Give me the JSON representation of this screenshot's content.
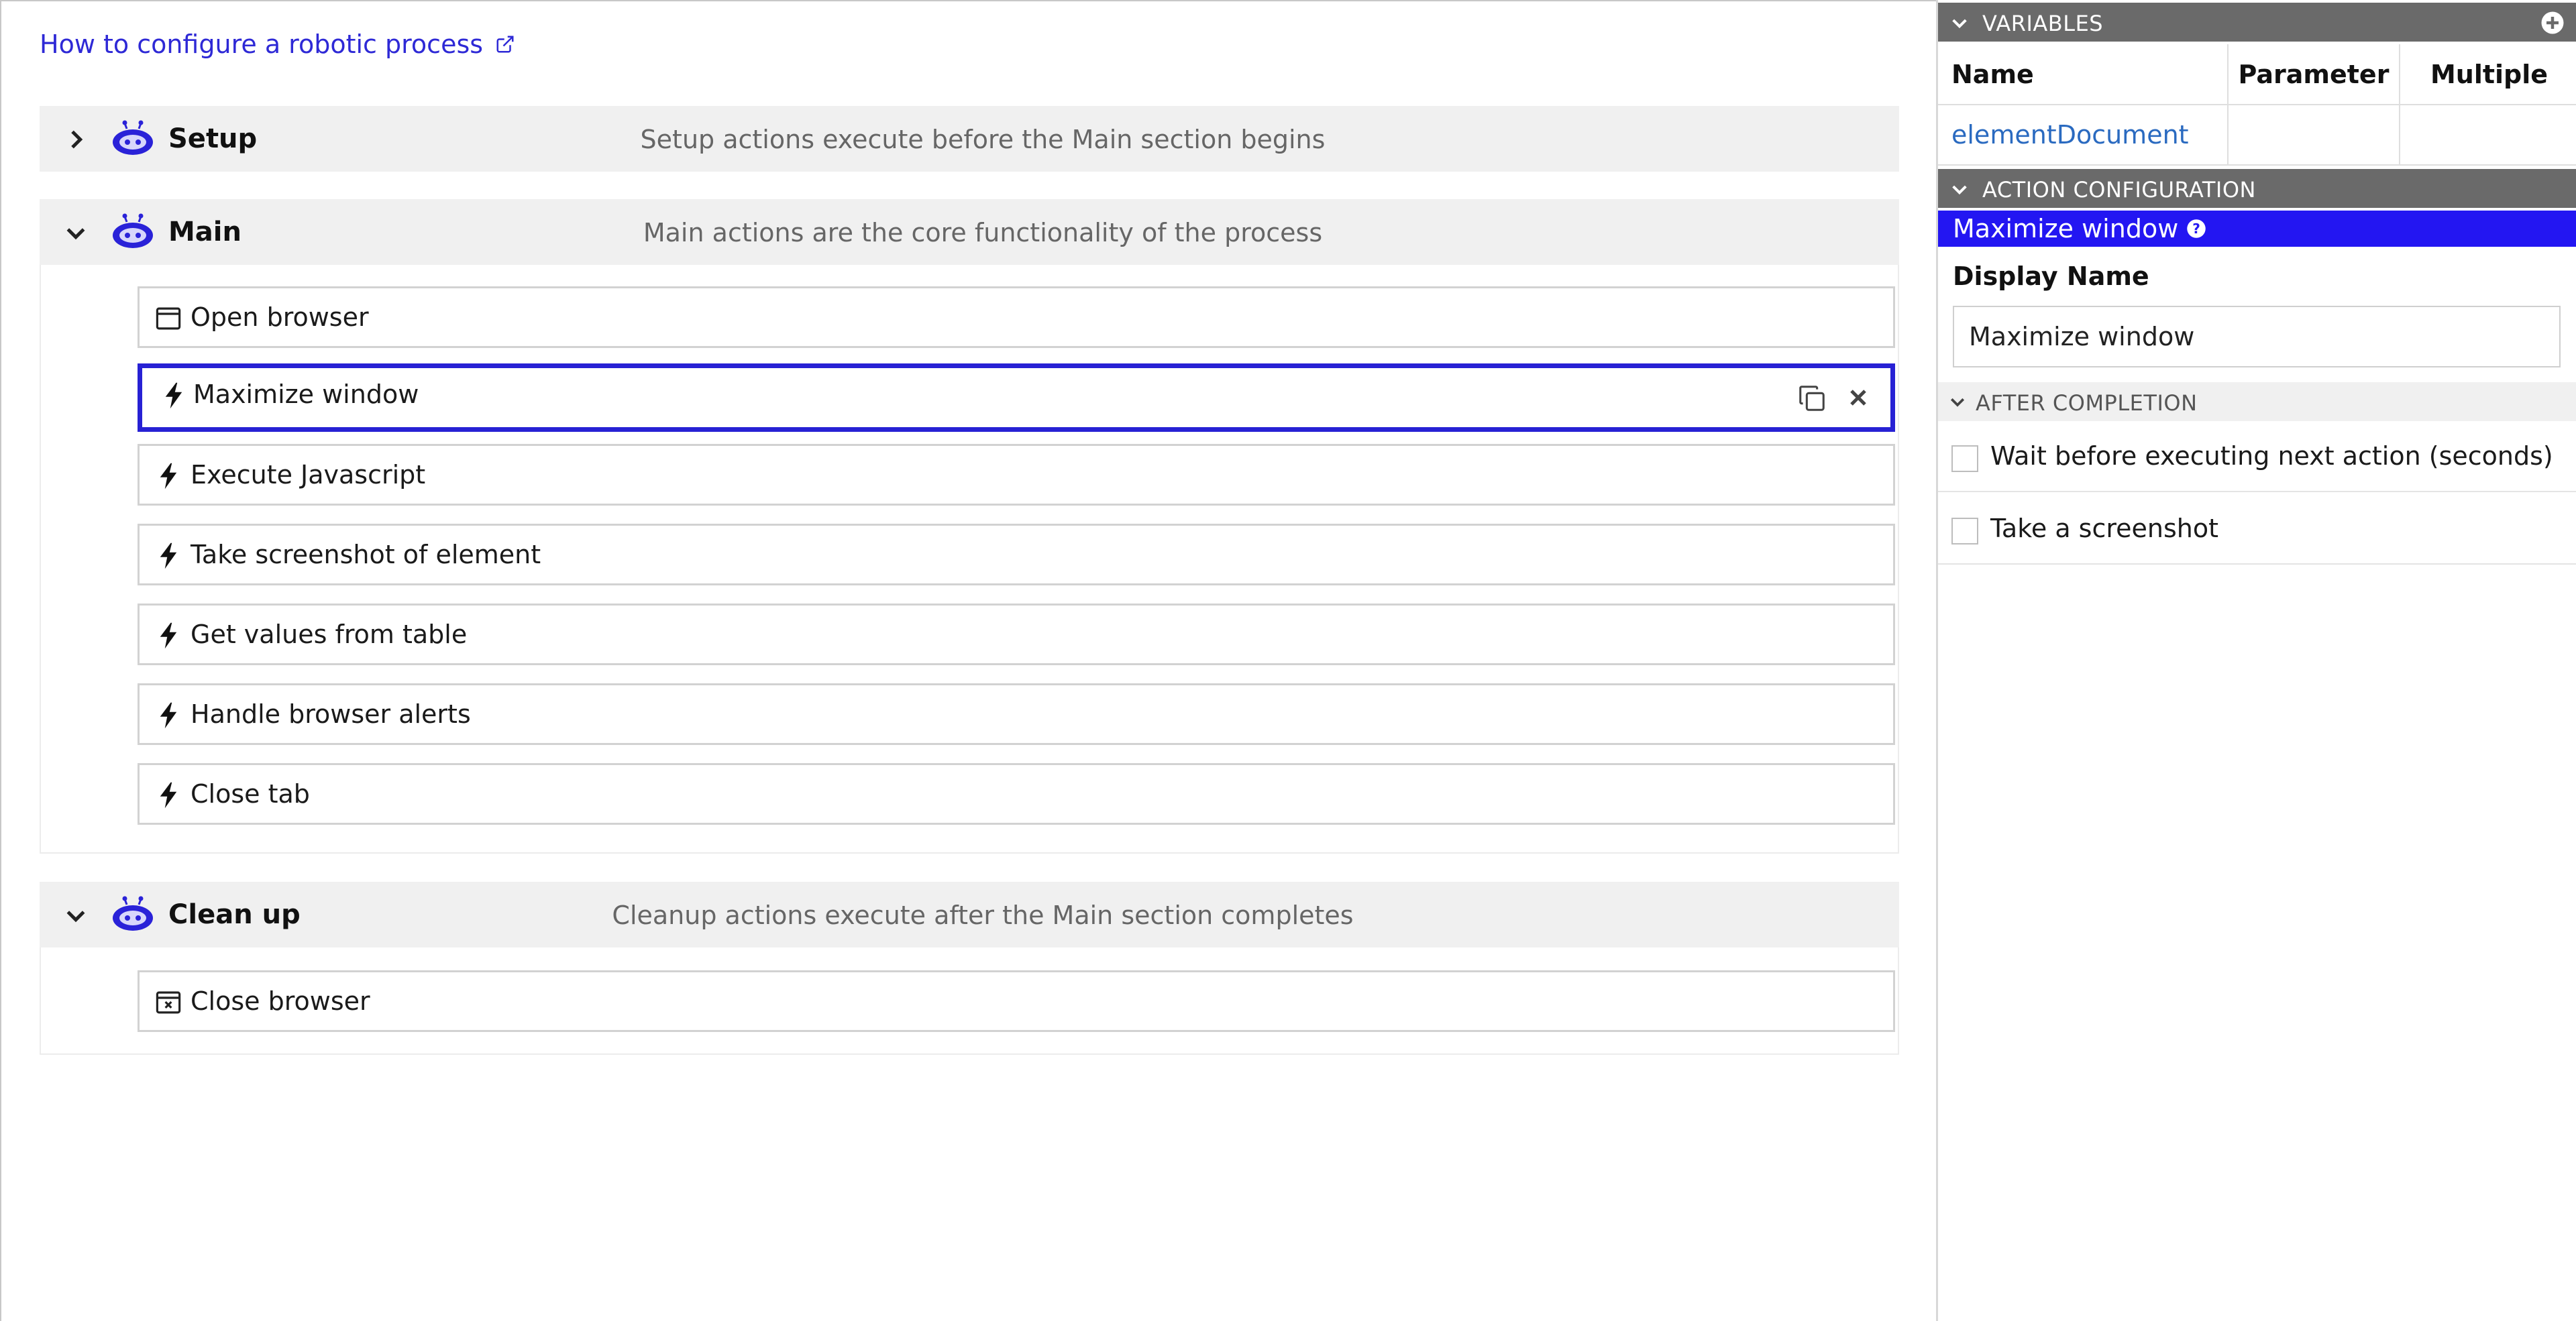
{
  "help_link": {
    "label": "How to configure a robotic process"
  },
  "sections": [
    {
      "title": "Setup",
      "description": "Setup actions execute before the Main section begins",
      "expanded": false
    },
    {
      "title": "Main",
      "description": "Main actions are the core functionality of the process",
      "expanded": true,
      "actions": [
        {
          "label": "Open browser",
          "icon": "browser-window-icon"
        },
        {
          "label": "Maximize window",
          "icon": "lightning-icon",
          "selected": true
        },
        {
          "label": "Execute Javascript",
          "icon": "lightning-icon"
        },
        {
          "label": "Take screenshot of element",
          "icon": "lightning-icon"
        },
        {
          "label": "Get values from table",
          "icon": "lightning-icon"
        },
        {
          "label": "Handle browser alerts",
          "icon": "lightning-icon"
        },
        {
          "label": "Close tab",
          "icon": "lightning-icon"
        }
      ]
    },
    {
      "title": "Clean up",
      "description": "Cleanup actions execute after the Main section completes",
      "expanded": true,
      "actions": [
        {
          "label": "Close browser",
          "icon": "close-browser-icon"
        }
      ]
    }
  ],
  "variables": {
    "header": "VARIABLES",
    "columns": [
      "Name",
      "Parameter",
      "Multiple"
    ],
    "rows": [
      {
        "name": "elementDocument",
        "parameter": "",
        "multiple": ""
      }
    ]
  },
  "action_configuration": {
    "header": "ACTION CONFIGURATION",
    "title": "Maximize window",
    "display_name_label": "Display Name",
    "display_name_value": "Maximize window",
    "after_completion": {
      "header": "AFTER COMPLETION",
      "options": [
        {
          "label": "Wait before executing next action (seconds)",
          "checked": false
        },
        {
          "label": "Take a screenshot",
          "checked": false
        }
      ]
    }
  },
  "colors": {
    "accent_blue": "#2316f2",
    "selected_border": "#2721d4",
    "link_blue": "#2e29d6",
    "panel_header": "#6a6a6a"
  }
}
